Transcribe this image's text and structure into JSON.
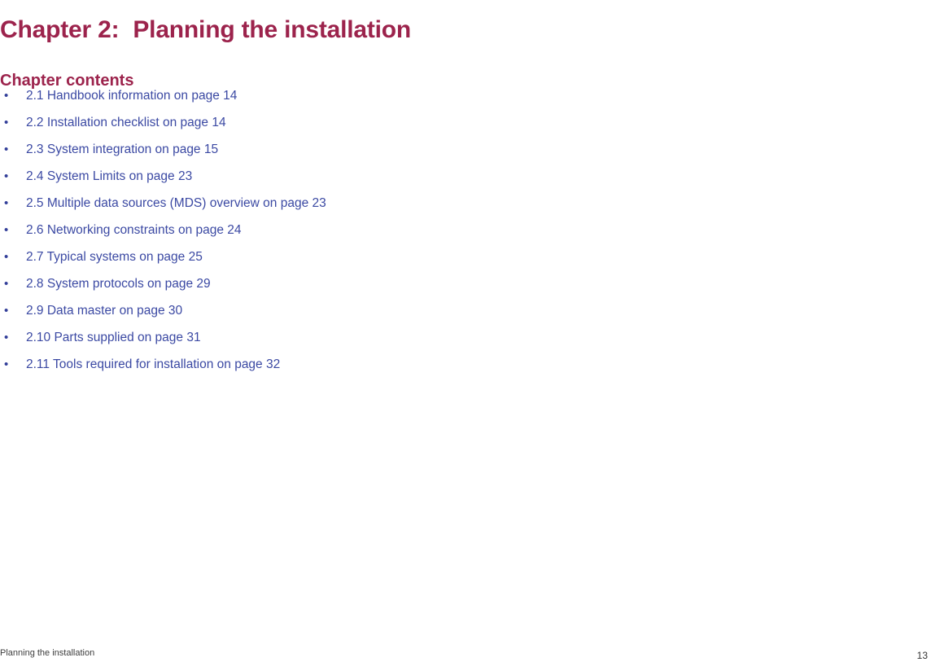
{
  "page": {
    "chapter_number_label": "Chapter 2:",
    "chapter_title": "Planning the installation",
    "contents_heading": "Chapter contents",
    "bullet_glyph": "•",
    "colors": {
      "heading": "#9c234c",
      "link": "#3b49a3",
      "footer_text": "#3d3d3d",
      "background": "#ffffff"
    }
  },
  "contents": [
    {
      "label": "2.1 Handbook information on page 14"
    },
    {
      "label": "2.2 Installation checklist on page 14"
    },
    {
      "label": "2.3 System integration on page 15"
    },
    {
      "label": "2.4 System Limits on page 23"
    },
    {
      "label": "2.5 Multiple data sources (MDS) overview on page 23"
    },
    {
      "label": "2.6 Networking constraints on page 24"
    },
    {
      "label": "2.7 Typical systems on page 25"
    },
    {
      "label": "2.8 System protocols on page 29"
    },
    {
      "label": "2.9 Data master on page 30"
    },
    {
      "label": "2.10 Parts supplied on page 31"
    },
    {
      "label": "2.11 Tools required for installation on page 32"
    }
  ],
  "footer": {
    "running_text": "Planning the installation",
    "page_number": "13"
  }
}
